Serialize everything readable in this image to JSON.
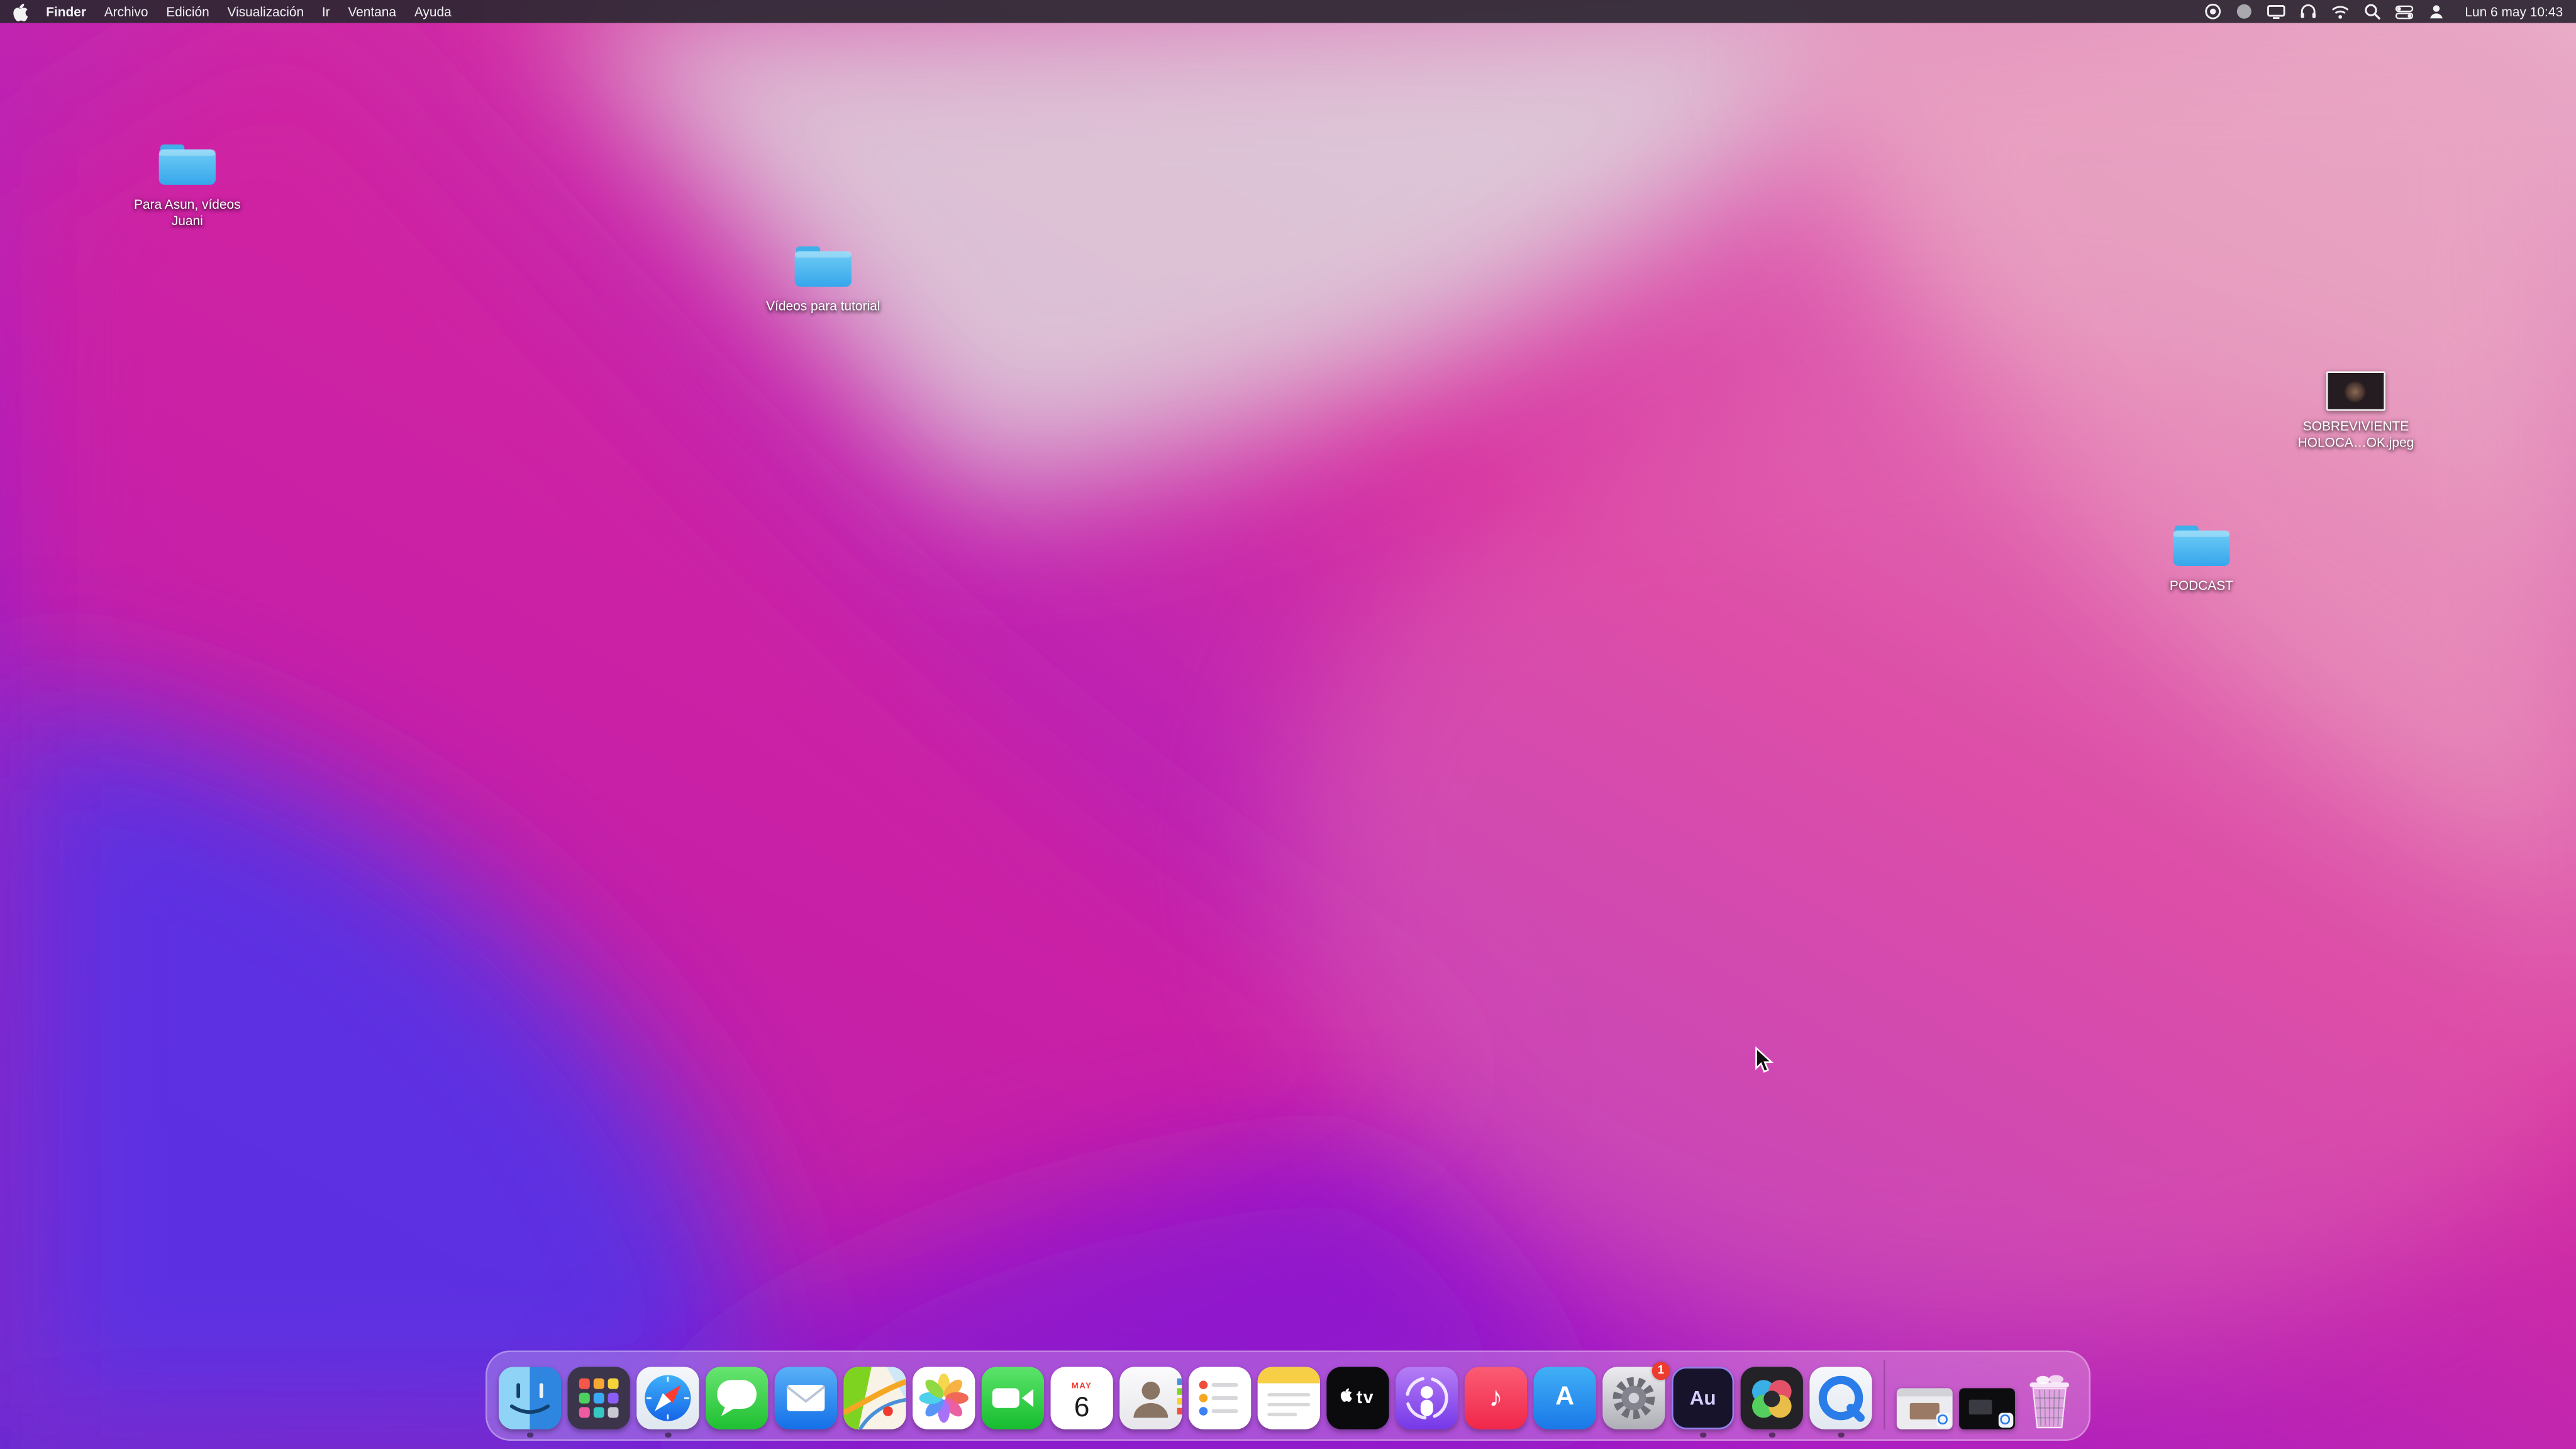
{
  "menu_bar": {
    "app_name": "Finder",
    "items": [
      "Finder",
      "Archivo",
      "Edición",
      "Visualización",
      "Ir",
      "Ventana",
      "Ayuda"
    ],
    "status_icons": [
      "screen-record-icon",
      "creative-cloud-icon",
      "display-icon",
      "headphones-icon",
      "wifi-icon",
      "search-icon",
      "control-center-icon",
      "user-switch-icon"
    ],
    "clock": "Lun 6 may 10:43"
  },
  "desktop": {
    "icons": [
      {
        "type": "folder",
        "label": "Para Asun, vídeos Juani"
      },
      {
        "type": "folder",
        "label": "Vídeos para tutorial"
      },
      {
        "type": "image",
        "label": "SOBREVIVIENTE HOLOCA…OK.jpeg"
      },
      {
        "type": "folder",
        "label": "PODCAST"
      }
    ]
  },
  "dock": {
    "apps": [
      "finder",
      "launchpad",
      "safari",
      "messages",
      "mail",
      "maps",
      "photos",
      "facetime",
      "calendar",
      "contacts",
      "reminders",
      "notes",
      "apple-tv",
      "podcasts",
      "music",
      "app-store",
      "system-preferences",
      "adobe-audition",
      "davinci-resolve",
      "quicktime-player"
    ],
    "minimized_windows": [
      "minimized-window-1",
      "minimized-window-2"
    ],
    "trash": "trash",
    "calendar_month": "MAY",
    "calendar_day": "6",
    "tv_text": "tv",
    "audition_text": "Au",
    "appstore_text": "A",
    "music_glyph": "♪",
    "settings_badge": "1"
  },
  "colors": {
    "folder_blue": "#4fbdf0",
    "menubar_bg": "#2c2632",
    "badge_red": "#ee3b2f"
  }
}
